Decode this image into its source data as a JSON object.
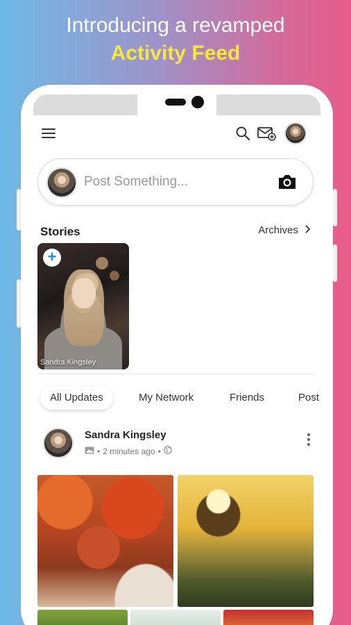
{
  "promo": {
    "line1": "Introducing a revamped",
    "line2": "Activity Feed",
    "colors": {
      "line1": "#ffffff",
      "line2": "#f7e83a"
    }
  },
  "appbar": {
    "menu_icon": "hamburger-icon",
    "search_icon": "search-icon",
    "messages_icon": "mail-icon",
    "profile_icon": "avatar"
  },
  "composer": {
    "placeholder": "Post Something...",
    "camera_icon": "camera-icon"
  },
  "stories": {
    "title": "Stories",
    "archives_label": "Archives",
    "items": [
      {
        "name": "Sandra Kingsley",
        "add_icon": "plus-icon"
      }
    ]
  },
  "tabs": [
    {
      "label": "All Updates",
      "active": true
    },
    {
      "label": "My Network",
      "active": false
    },
    {
      "label": "Friends",
      "active": false
    },
    {
      "label": "Post",
      "active": false
    }
  ],
  "post": {
    "author": "Sandra Kingsley",
    "time": "2 minutes ago",
    "meta_icons": [
      "image-icon",
      "globe-icon"
    ],
    "separator": "•"
  },
  "colors": {
    "accent": "#1e88e5",
    "background_left": "#6fb9e6",
    "background_right": "#e85c8a"
  }
}
